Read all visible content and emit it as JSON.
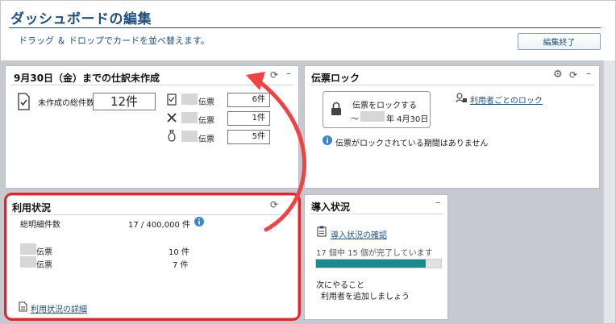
{
  "header": {
    "title": "ダッシュボードの編集",
    "subtitle": "ドラッグ ＆ ドロップでカードを並べ替えます。",
    "done_label": "編集終了"
  },
  "card_unprocessed": {
    "title": "9月30日（金）までの仕訳未作成",
    "total_label": "未作成の総件数",
    "total_value": "12件",
    "rows": [
      {
        "label": "伝票",
        "value": "6件",
        "icon": "document-check-icon"
      },
      {
        "label": "伝票",
        "value": "1件",
        "icon": "crossed-tools-icon"
      },
      {
        "label": "伝票",
        "value": "5件",
        "icon": "money-bag-icon"
      }
    ]
  },
  "card_lock": {
    "title": "伝票ロック",
    "lock_line1": "伝票をロックする",
    "lock_prefix": "〜",
    "lock_line2": "年 4月30日",
    "user_lock_link": "利用者ごとのロック",
    "info_text": "伝票がロックされている期間はありません"
  },
  "card_usage": {
    "title": "利用状況",
    "detail_label": "総明細件数",
    "detail_value": "17 / 400,000 件",
    "rows": [
      {
        "label": "伝票",
        "value": "10 件"
      },
      {
        "label": "伝票",
        "value": "7 件"
      }
    ],
    "detail_link": "利用状況の詳細"
  },
  "card_intro": {
    "title": "導入状況",
    "check_link": "導入状況の確認",
    "progress_text": "17 個中 15 個が完了しています",
    "progress": 0.88,
    "next_title": "次にやること",
    "next_item": "利用者を追加しましょう"
  },
  "colors": {
    "accent": "#1f4f7a",
    "highlight": "#e3242b",
    "progress_fill": "#1a8a8e",
    "board_bg": "#c6c9d2"
  }
}
